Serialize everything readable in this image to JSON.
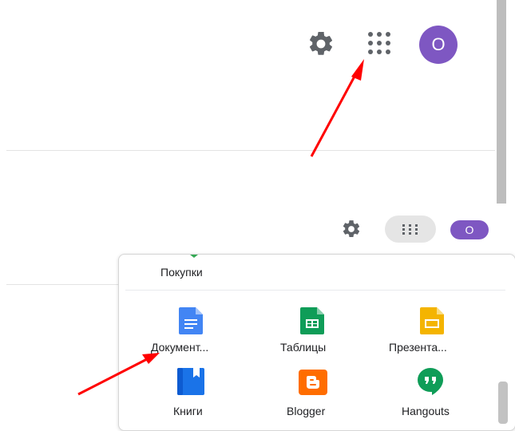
{
  "top_bar": {
    "settings_icon": "gear-icon",
    "apps_icon": "apps-grid-icon",
    "avatar_letter": "О"
  },
  "bottom_bar": {
    "settings_icon": "gear-icon",
    "apps_icon": "apps-grid-icon",
    "avatar_letter": "О"
  },
  "apps_panel": {
    "partial_item": {
      "label": "Покупки",
      "icon": "shopping-icon",
      "color": "#34a853"
    },
    "items": [
      {
        "label": "Документ...",
        "icon": "docs-icon",
        "color": "#4285f4"
      },
      {
        "label": "Таблицы",
        "icon": "sheets-icon",
        "color": "#0f9d58"
      },
      {
        "label": "Презента...",
        "icon": "slides-icon",
        "color": "#f4b400"
      },
      {
        "label": "Книги",
        "icon": "books-icon",
        "color": "#1a73e8"
      },
      {
        "label": "Blogger",
        "icon": "blogger-icon",
        "color": "#ff6d00"
      },
      {
        "label": "Hangouts",
        "icon": "hangouts-icon",
        "color": "#0f9d58"
      }
    ]
  },
  "colors": {
    "avatar": "#7e57c2",
    "arrow": "#ff0000",
    "divider": "#e3e3e3"
  }
}
